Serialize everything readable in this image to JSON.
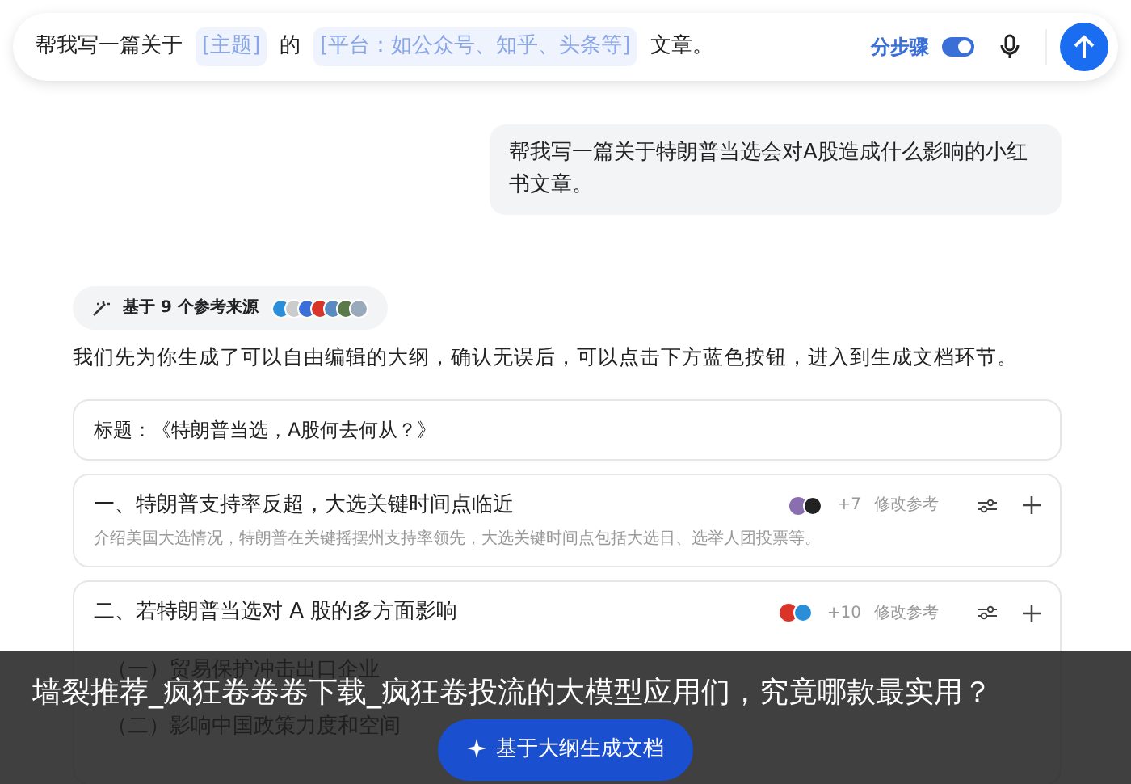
{
  "prompt_bar": {
    "segments": [
      {
        "kind": "text",
        "text": "帮我写一篇关于"
      },
      {
        "kind": "slot",
        "text": "[主题]"
      },
      {
        "kind": "text",
        "text": "的"
      },
      {
        "kind": "slot",
        "text": "[平台：如公众号、知乎、头条等]"
      },
      {
        "kind": "text",
        "text": "文章。"
      }
    ],
    "step_toggle": {
      "label": "分步骤",
      "on": true
    }
  },
  "user_message": "帮我写一篇关于特朗普当选会对A股造成什么影响的小红书文章。",
  "sources_chip": "基于 9 个参考来源",
  "intro": "我们先为你生成了可以自由编辑的大纲，确认无误后，可以点击下方蓝色按钮，进入到生成文档环节。",
  "outline_title": "标题：《特朗普当选，A股何去何从？》",
  "sections": [
    {
      "title": "一、特朗普支持率反超，大选关键时间点临近",
      "description": "介绍美国大选情况，特朗普在关键摇摆州支持率领先，大选关键时间点包括大选日、选举人团投票等。",
      "ref_count": "+7",
      "edit_refs": "修改参考"
    },
    {
      "title": "二、若特朗普当选对 A 股的多方面影响",
      "ref_count": "+10",
      "edit_refs": "修改参考",
      "children": [
        {
          "title": "（一）贸易保护冲击出口企业"
        },
        {
          "title": "（二）影响中国政策力度和空间"
        }
      ]
    }
  ],
  "generate_button": "基于大纲生成文档",
  "caption": "墙裂推荐_疯狂卷卷卷下载_疯狂卷投流的大模型应用们，究竟哪款最实用？"
}
